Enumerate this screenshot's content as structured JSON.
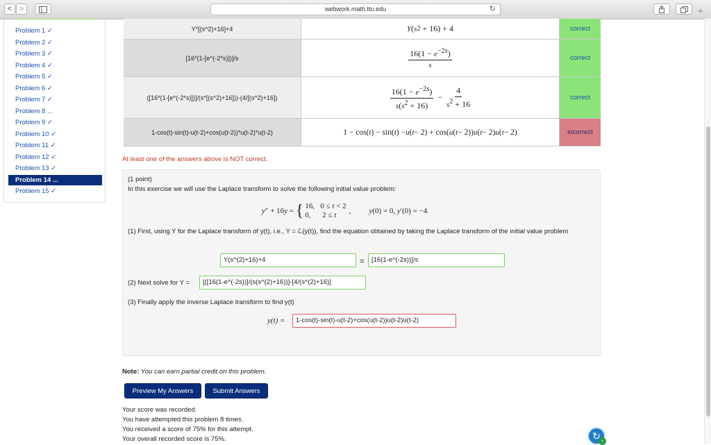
{
  "browser": {
    "back_glyph": "<",
    "forward_glyph": ">",
    "url": "webwork.math.ttu.edu",
    "reload_glyph": "↻",
    "new_tab_glyph": "+"
  },
  "sidebar": {
    "items": [
      {
        "label": "Problem 1 ✓"
      },
      {
        "label": "Problem 2 ✓"
      },
      {
        "label": "Problem 3 ✓"
      },
      {
        "label": "Problem 4 ✓"
      },
      {
        "label": "Problem 5 ✓"
      },
      {
        "label": "Problem 6 ✓"
      },
      {
        "label": "Problem 7 ✓"
      },
      {
        "label": "Problem 8 ..."
      },
      {
        "label": "Problem 9 ✓"
      },
      {
        "label": "Problem 10 ✓"
      },
      {
        "label": "Problem 11 ✓"
      },
      {
        "label": "Problem 12 ✓"
      },
      {
        "label": "Problem 13 ✓"
      },
      {
        "label": "Problem 14 ..."
      },
      {
        "label": "Problem 15 ✓"
      }
    ],
    "active_index": 13
  },
  "results": {
    "rows": [
      {
        "entered": "Y*[(s^2)+16]+4",
        "status": "correct"
      },
      {
        "entered": "[16*(1-[e^(-2*s)])]/s",
        "status": "correct"
      },
      {
        "entered": "([16*(1-[e^(-2*s)])]/(s*[(s^2)+16]))-(4/[(s^2)+16])",
        "status": "correct"
      },
      {
        "entered": "1-cos(t)-sin(t)-u(t-2)+cos(u(t-2))*u(t-2)*u(t-2)",
        "status": "incorrect"
      }
    ],
    "message": "At least one of the answers above is NOT correct."
  },
  "problem": {
    "points": "(1 point)",
    "intro": "In this exercise we will use the Laplace transform to solve the following initial value problem:",
    "step1": "(1) First, using Y for the Laplace transform of y(t), i.e., Y = ℒ(y(t)), find the equation obtained by taking the Laplace transform of the initial value problem",
    "answer1_left": "Y(s^(2)+16)+4",
    "equals": "=",
    "answer1_right": "[16(1-e^(-2s))]/s",
    "step2_label": "(2) Next solve for Y =",
    "answer2": "[([16(1-e^(-2s))]/(s(s^(2)+16))]-[4/(s^(2)+16)]",
    "step3": "(3) Finally apply the inverse Laplace transform to find y(t)",
    "answer3_label": "y(t) =",
    "answer3": "1-cos(t)-sin(t)-u(t-2)+cos(u(t-2))u(t-2)u(t-2)"
  },
  "note": {
    "bold": "Note:",
    "text": "You can earn partial credit on this problem."
  },
  "buttons": {
    "preview": "Preview My Answers",
    "submit": "Submit Answers"
  },
  "status": {
    "line1": "Your score was recorded.",
    "line2": "You have attempted this problem 8 times.",
    "line3": "You received a score of 75% for this attempt.",
    "line4": "Your overall recorded score is 75%."
  },
  "colors": {
    "correct_bg": "#8ce37a",
    "incorrect_bg": "#d97f86",
    "nav_active": "#0b2e7c",
    "error_text": "#c0392b"
  },
  "icons": [
    "sidebar-toggle-icon",
    "share-icon",
    "tabs-icon",
    "reload-icon",
    "help-widget-icon"
  ]
}
